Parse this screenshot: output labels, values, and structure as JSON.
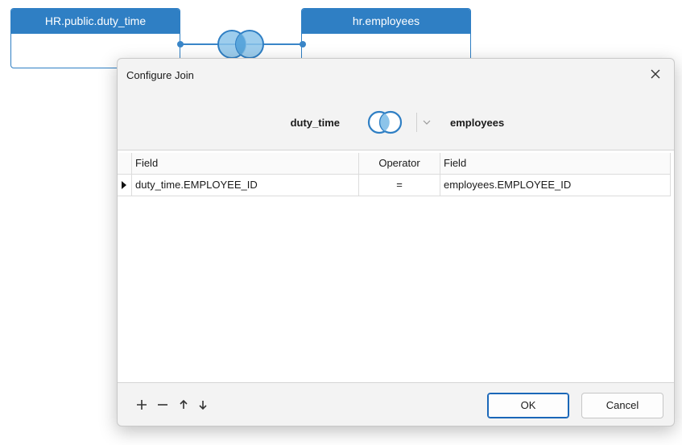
{
  "canvas": {
    "left_table": {
      "title": "HR.public.duty_time"
    },
    "right_table": {
      "title": "hr.employees"
    }
  },
  "dialog": {
    "title": "Configure Join",
    "close_icon": "close-icon",
    "left_table_name": "duty_time",
    "right_table_name": "employees",
    "join_type_icon": "inner-join-icon",
    "grid": {
      "headers": {
        "left_field": "Field",
        "operator": "Operator",
        "right_field": "Field"
      },
      "rows": [
        {
          "left_field": "duty_time.EMPLOYEE_ID",
          "operator": "=",
          "right_field": "employees.EMPLOYEE_ID"
        }
      ]
    },
    "toolbar": {
      "add_icon": "plus-icon",
      "remove_icon": "minus-icon",
      "up_icon": "arrow-up-icon",
      "down_icon": "arrow-down-icon"
    },
    "buttons": {
      "ok": "OK",
      "cancel": "Cancel"
    }
  },
  "colors": {
    "accent": "#2f7fc4",
    "join_circle": "#8cc4ea",
    "ok_border": "#1a67b8"
  }
}
